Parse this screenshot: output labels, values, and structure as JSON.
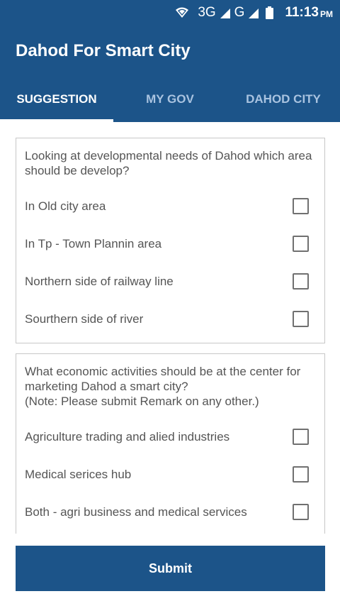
{
  "status_bar": {
    "network": "3G",
    "network2": "G",
    "time": "11:13",
    "ampm": "PM"
  },
  "app": {
    "title": "Dahod For Smart City"
  },
  "tabs": [
    {
      "label": "SUGGESTION",
      "active": true
    },
    {
      "label": "MY GOV",
      "active": false
    },
    {
      "label": "DAHOD CITY",
      "active": false
    }
  ],
  "questions": [
    {
      "text": "Looking at developmental needs of Dahod which area should be develop?",
      "options": [
        {
          "label": "In Old city area",
          "checked": false
        },
        {
          "label": "In Tp - Town Plannin area",
          "checked": false
        },
        {
          "label": "Northern side of railway line",
          "checked": false
        },
        {
          "label": "Sourthern side of river",
          "checked": false
        }
      ]
    },
    {
      "text": "What economic activities should be at the center for marketing Dahod a smart city?\n(Note: Please submit Remark on any other.)",
      "options": [
        {
          "label": "Agriculture trading and alied industries",
          "checked": false
        },
        {
          "label": "Medical serices hub",
          "checked": false
        },
        {
          "label": "Both - agri business and medical services",
          "checked": false
        }
      ]
    }
  ],
  "submit_label": "Submit",
  "colors": {
    "primary": "#1c5489",
    "tab_inactive": "#a9c3e0",
    "text": "#555555"
  },
  "icons": [
    "wifi-icon",
    "signal-icon",
    "battery-icon"
  ]
}
